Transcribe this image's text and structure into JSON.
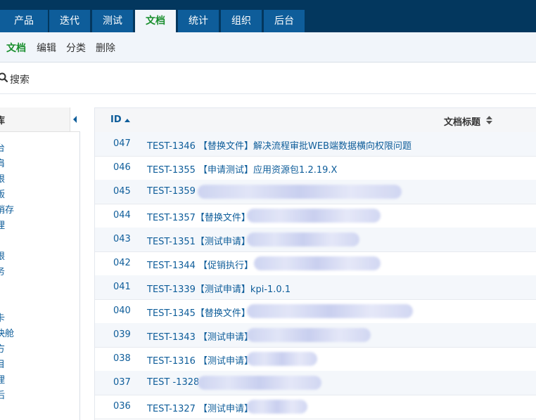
{
  "topnav": {
    "tabs": [
      {
        "label": "产品",
        "active": false
      },
      {
        "label": "迭代",
        "active": false
      },
      {
        "label": "测试",
        "active": false
      },
      {
        "label": "文档",
        "active": true
      },
      {
        "label": "统计",
        "active": false
      },
      {
        "label": "组织",
        "active": false
      },
      {
        "label": "后台",
        "active": false
      }
    ]
  },
  "subnav": {
    "items": [
      {
        "label": "文档",
        "active": true
      },
      {
        "label": "编辑",
        "active": false
      },
      {
        "label": "分类",
        "active": false
      },
      {
        "label": "删除",
        "active": false
      }
    ]
  },
  "search": {
    "label": "搜索",
    "icon": "search-icon"
  },
  "sidebar": {
    "title": "库",
    "items": [
      "台",
      "肩",
      "限",
      "版",
      "销存",
      "理",
      "",
      "限",
      "务",
      "",
      "",
      "卡",
      "快舱",
      "方",
      "目",
      "理",
      "后"
    ]
  },
  "table": {
    "columns": {
      "id": "ID",
      "title": "文档标题"
    },
    "rows": [
      {
        "id": "047",
        "title": "TEST-1346 【替换文件】解决流程审批WEB端数据横向权限问题"
      },
      {
        "id": "046",
        "title": "TEST-1355 【申请测试】应用资源包1.2.19.X"
      },
      {
        "id": "045",
        "title": "TEST-1359"
      },
      {
        "id": "044",
        "title": "TEST-1357【替换文件】"
      },
      {
        "id": "043",
        "title": "TEST-1351【测试申请】"
      },
      {
        "id": "042",
        "title": "TEST-1344 【促销执行】"
      },
      {
        "id": "041",
        "title": "TEST-1339【测试申请】kpi-1.0.1"
      },
      {
        "id": "040",
        "title": "TEST-1345【替换文件】"
      },
      {
        "id": "039",
        "title": "TEST-1343 【测试申请】"
      },
      {
        "id": "038",
        "title": "TEST-1316 【测试申请】"
      },
      {
        "id": "037",
        "title": "TEST -1328"
      },
      {
        "id": "036",
        "title": "TEST-1327 【测试申请】"
      }
    ]
  },
  "colors": {
    "topbar": "#03375e",
    "tab": "#0e5d9a",
    "active_text": "#1a8f2e",
    "link": "#0e5d9a"
  }
}
